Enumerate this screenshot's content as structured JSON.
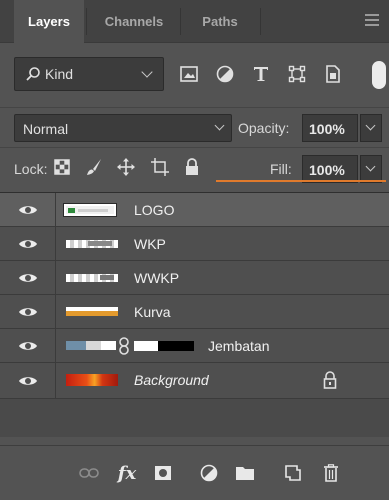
{
  "tabs": [
    {
      "label": "Layers",
      "active": true
    },
    {
      "label": "Channels",
      "active": false
    },
    {
      "label": "Paths",
      "active": false
    }
  ],
  "filter": {
    "kind_label": "Kind",
    "icons": [
      "image-filter-icon",
      "adjustment-filter-icon",
      "type-filter-icon",
      "shape-filter-icon",
      "smart-object-filter-icon"
    ]
  },
  "blend": {
    "mode": "Normal",
    "opacity_label": "Opacity:",
    "opacity_value": "100%"
  },
  "lock": {
    "label": "Lock:",
    "fill_label": "Fill:",
    "fill_value": "100%"
  },
  "layers": [
    {
      "name": "LOGO",
      "selected": true
    },
    {
      "name": "WKP",
      "selected": false
    },
    {
      "name": "WWKP",
      "selected": false
    },
    {
      "name": "Kurva",
      "selected": false
    },
    {
      "name": "Jembatan",
      "selected": false
    },
    {
      "name": "Background",
      "selected": false
    }
  ],
  "colors": {
    "panel_bg": "#535353",
    "tabbar_bg": "#424242",
    "annotation_arrow": "#e07a2c"
  }
}
